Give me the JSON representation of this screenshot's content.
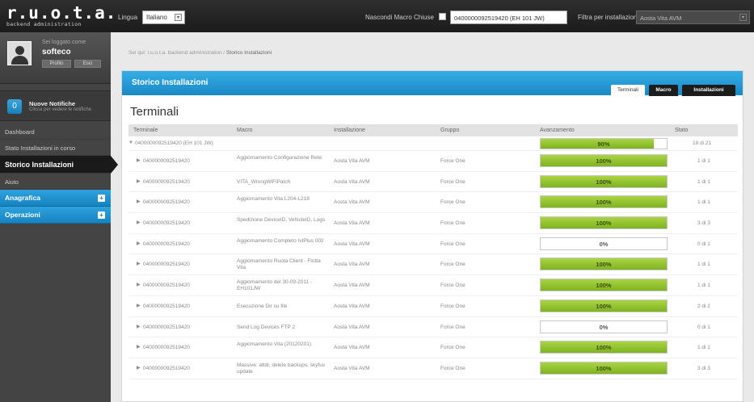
{
  "topbar": {
    "logo_main": "r.u.o.t.a.",
    "logo_sub": "backend administration",
    "lingua_label": "Lingua",
    "lingua_value": "Italiano",
    "hide_closed_label": "Nascondi Macro Chiuse",
    "terminal_value": "0400000092519420 (EH 101 JW)",
    "filter_label": "Filtra per installazione",
    "filter_value": "Aosta Vita AVM",
    "select_arrow": "▾"
  },
  "sidebar": {
    "logged_label": "Sei loggato come",
    "username": "softeco",
    "btn_profile": "Profilo",
    "btn_exit": "Esci",
    "notif_title": "Nuove Notifiche",
    "notif_sub": "Clicca per vedere le notifiche",
    "notif_count": "0",
    "items": [
      {
        "label": "Dashboard"
      },
      {
        "label": "Stato Installazioni in corso"
      },
      {
        "label": "Storico Installazioni"
      },
      {
        "label": "Aiuto"
      }
    ],
    "sections": [
      {
        "label": "Anagrafica",
        "plus": "+"
      },
      {
        "label": "Operazioni",
        "plus": "+"
      }
    ]
  },
  "breadcrumb": {
    "prefix": "Sei qui: r.u.o.t.a. backend administration /",
    "current": "Storico Installazioni"
  },
  "panel": {
    "title": "Storico Installazioni",
    "tabs": [
      {
        "label": "Terminali"
      },
      {
        "label": "Macro"
      },
      {
        "label": "Installazioni"
      }
    ],
    "section_title": "Terminali"
  },
  "table": {
    "headers": [
      "Terminale",
      "Macro",
      "Installazione",
      "Gruppo",
      "Avanzamento",
      "Stato"
    ],
    "top_row": {
      "terminal": "0400000092519420 (EH 101 JW)",
      "progress": 90,
      "progress_label": "90%",
      "status": "19 di 21",
      "expander": "▼"
    },
    "rows": [
      {
        "terminal": "0400000092519420",
        "macro": "Aggiornamento Configurazione Rete",
        "installation": "Aosta Vita AVM",
        "group": "Force One",
        "progress": 100,
        "progress_label": "100%",
        "status": "1 di 1"
      },
      {
        "terminal": "0400000092519420",
        "macro": "VITA_WrongWiFiPatch",
        "installation": "Aosta Vita AVM",
        "group": "Force One",
        "progress": 100,
        "progress_label": "100%",
        "status": "1 di 1"
      },
      {
        "terminal": "0400000092519420",
        "macro": "Aggiornamento Vita L204-L218",
        "installation": "Aosta Vita AVM",
        "group": "Force One",
        "progress": 100,
        "progress_label": "100%",
        "status": "1 di 1"
      },
      {
        "terminal": "0400000092519420",
        "macro": "Spedizione DeviceID, VehicleID, Logs",
        "installation": "Aosta Vita AVM",
        "group": "Force One",
        "progress": 100,
        "progress_label": "100%",
        "status": "3 di 3"
      },
      {
        "terminal": "0400000092519420",
        "macro": "Aggiornamento Completo IvtPlus 002",
        "installation": "Aosta Vita AVM",
        "group": "Force One",
        "progress": 0,
        "progress_label": "0%",
        "status": "0 di 1"
      },
      {
        "terminal": "0400000092519420",
        "macro": "Aggiornamento Ruota Client - Flotta Vita",
        "installation": "Aosta Vita AVM",
        "group": "Force One",
        "progress": 100,
        "progress_label": "100%",
        "status": "1 di 1"
      },
      {
        "terminal": "0400000092519420",
        "macro": "Aggiornamento del 30-09-2011 - EH101JW",
        "installation": "Aosta Vita AVM",
        "group": "Force One",
        "progress": 100,
        "progress_label": "100%",
        "status": "1 di 1"
      },
      {
        "terminal": "0400000092519420",
        "macro": "Esecuzione Dir su file",
        "installation": "Aosta Vita AVM",
        "group": "Force One",
        "progress": 100,
        "progress_label": "100%",
        "status": "2 di 2"
      },
      {
        "terminal": "0400000092519420",
        "macro": "Send Log Devices FTP 2",
        "installation": "Aosta Vita AVM",
        "group": "Force One",
        "progress": 0,
        "progress_label": "0%",
        "status": "0 di 1"
      },
      {
        "terminal": "0400000092519420",
        "macro": "Aggiornamento Vita (20120201)",
        "installation": "Aosta Vita AVM",
        "group": "Force One",
        "progress": 100,
        "progress_label": "100%",
        "status": "1 di 1"
      },
      {
        "terminal": "0400000092519420",
        "macro": "Massive: attdi, delete backups, skyfus update",
        "installation": "Aosta Vita AVM",
        "group": "Force One",
        "progress": 100,
        "progress_label": "100%",
        "status": "3 di 3"
      }
    ],
    "row_expander": "▶"
  }
}
